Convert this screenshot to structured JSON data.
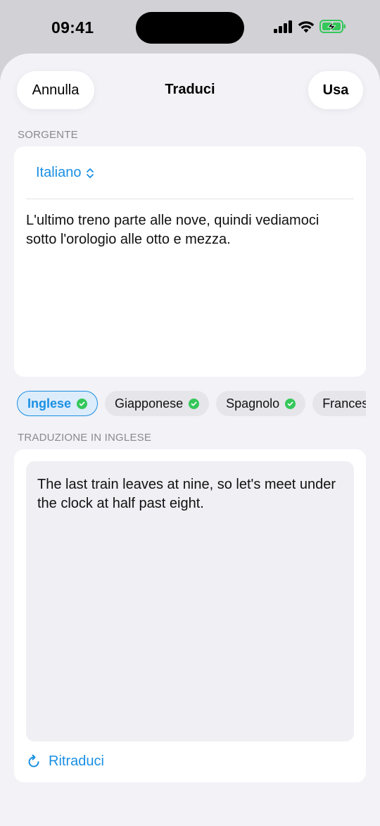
{
  "status": {
    "time": "09:41"
  },
  "nav": {
    "cancel": "Annulla",
    "title": "Traduci",
    "use": "Usa"
  },
  "source": {
    "section_label": "SORGENTE",
    "language": "Italiano",
    "text": "L'ultimo treno parte alle nove, quindi vediamoci sotto l'orologio alle otto e mezza."
  },
  "languages": [
    {
      "label": "Inglese",
      "selected": true,
      "ready": true
    },
    {
      "label": "Giapponese",
      "selected": false,
      "ready": true
    },
    {
      "label": "Spagnolo",
      "selected": false,
      "ready": true
    },
    {
      "label": "Francese",
      "selected": false,
      "ready": false
    }
  ],
  "translation": {
    "section_label": "TRADUZIONE IN INGLESE",
    "text": "The last train leaves at nine, so let's meet under the clock at half past eight.",
    "retranslate": "Ritraduci"
  },
  "colors": {
    "accent": "#1a8fe3",
    "ready": "#34c759",
    "background": "#f2f2f7"
  }
}
